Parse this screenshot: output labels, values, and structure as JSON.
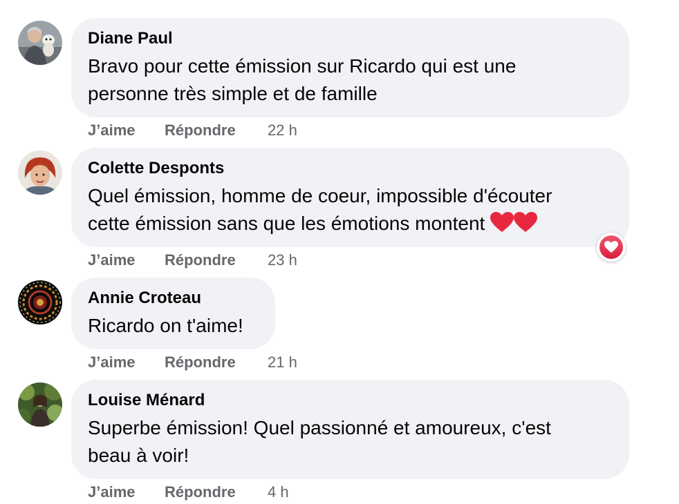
{
  "comments": [
    {
      "author": "Diane Paul",
      "text_line1": "Bravo pour cette émission sur Ricardo qui est une",
      "text_line2": "personne très simple et de famille",
      "like_label": "J’aime",
      "reply_label": "Répondre",
      "time": "22 h",
      "avatar_icon": "avatar-woman-with-dog"
    },
    {
      "author": "Colette Desponts",
      "text_line1": "Quel émission, homme de coeur, impossible d'écouter",
      "text_line2": "cette émission sans que les émotions montent",
      "like_label": "J’aime",
      "reply_label": "Répondre",
      "time": "23 h",
      "avatar_icon": "avatar-red-hair-woman",
      "reaction_icon": "love-reaction-icon"
    },
    {
      "author": "Annie Croteau",
      "text_line1": "Ricardo on t'aime!",
      "like_label": "J’aime",
      "reply_label": "Répondre",
      "time": "21 h",
      "avatar_icon": "avatar-mandala"
    },
    {
      "author": "Louise Ménard",
      "text_line1": "Superbe émission! Quel passionné et amoureux, c'est",
      "text_line2": "beau à voir!",
      "like_label": "J’aime",
      "reply_label": "Répondre",
      "time": "4 h",
      "avatar_icon": "avatar-woman-in-forest"
    }
  ],
  "colors": {
    "bubble": "#f0f2f5",
    "meta_text": "#65676b",
    "heart": "#e8283f"
  }
}
